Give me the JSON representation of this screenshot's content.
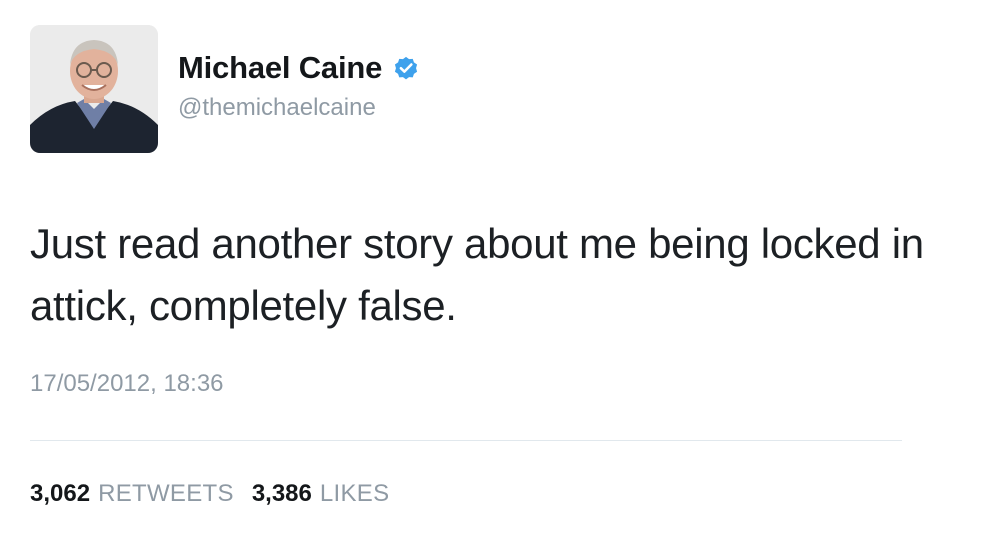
{
  "tweet": {
    "author": {
      "display_name": "Michael Caine",
      "handle": "@themichaelcaine",
      "verified": true,
      "avatar_icon": "profile-photo"
    },
    "text": "Just read another story about me being locked in attick, completely false.",
    "timestamp": "17/05/2012, 18:36",
    "stats": {
      "retweets_count": "3,062",
      "retweets_label": "RETWEETS",
      "likes_count": "3,386",
      "likes_label": "LIKES"
    }
  },
  "colors": {
    "text_primary": "#14171a",
    "text_secondary": "#8f9aa4",
    "verified_blue": "#1da1f2",
    "divider": "#e1e8ed"
  }
}
